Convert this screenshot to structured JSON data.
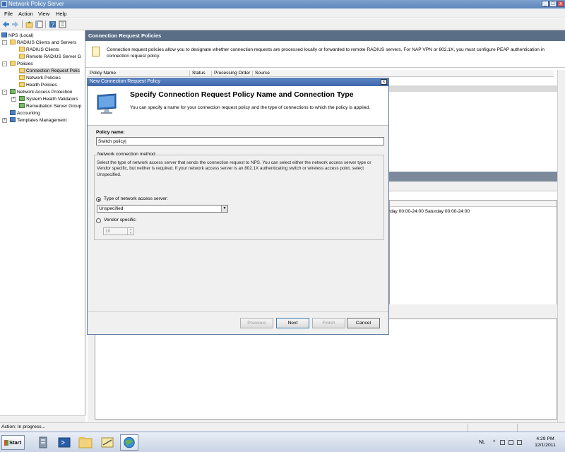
{
  "window": {
    "title": "Network Policy Server"
  },
  "menu": [
    "File",
    "Action",
    "View",
    "Help"
  ],
  "tree": {
    "root": "NPS (Local)",
    "items": [
      {
        "label": "RADIUS Clients and Servers",
        "level": 1,
        "expander": "-"
      },
      {
        "label": "RADIUS Clients",
        "level": 2
      },
      {
        "label": "Remote RADIUS Server G",
        "level": 2
      },
      {
        "label": "Policies",
        "level": 1,
        "expander": "-"
      },
      {
        "label": "Connection Request Polic",
        "level": 2,
        "selected": true
      },
      {
        "label": "Network Policies",
        "level": 2
      },
      {
        "label": "Health Policies",
        "level": 2
      },
      {
        "label": "Network Access Protection",
        "level": 1,
        "expander": "-"
      },
      {
        "label": "System Health Validators",
        "level": 2,
        "expander": "+"
      },
      {
        "label": "Remediation Server Group",
        "level": 2
      },
      {
        "label": "Accounting",
        "level": 1
      },
      {
        "label": "Templates Management",
        "level": 1,
        "expander": "+"
      }
    ]
  },
  "main": {
    "header": "Connection Request Policies",
    "info": "Connection request policies allow you to designate whether connection requests are processed locally or forwarded to remote RADIUS servers. For NAP VPN or 802.1X, you must configure PEAP authentication in connection request policy.",
    "columns": [
      "Policy Name",
      "Status",
      "Processing Order",
      "Source"
    ],
    "condition_value": "rday 00:00-24:00 Saturday 00:00-24:00"
  },
  "dialog": {
    "title": "New Connection Request Policy",
    "heading": "Specify Connection Request Policy Name and Connection Type",
    "subheading": "You can specify a name for your connection request policy and the type of connections to which the policy is applied.",
    "policy_name_label": "Policy name:",
    "policy_name_value": "Switch policy|",
    "group_title": "Network connection method",
    "group_desc": "Select the type of network access server that sends the connection request to NPS. You can select either the network access server type or Vendor specific, but neither is required.  If your network access server is an 802.1X authenticating switch or wireless access point, select Unspecified.",
    "radio_type_label": "Type of network access server:",
    "type_value": "Unspecified",
    "radio_vendor_label": "Vendor specific:",
    "vendor_value": "10",
    "buttons": {
      "previous": "Previous",
      "next": "Next",
      "finish": "Finish",
      "cancel": "Cancel"
    }
  },
  "status": {
    "text": "Action:  In progress..."
  },
  "taskbar": {
    "start": "Start",
    "lang": "NL",
    "time": "4:29 PM",
    "date": "12/1/2011"
  }
}
